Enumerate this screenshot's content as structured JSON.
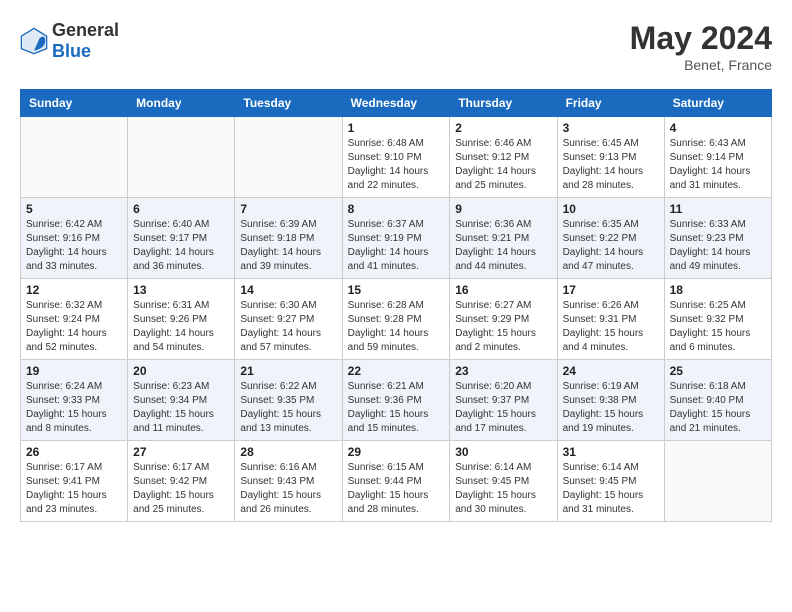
{
  "header": {
    "logo_general": "General",
    "logo_blue": "Blue",
    "month_year": "May 2024",
    "location": "Benet, France"
  },
  "weekdays": [
    "Sunday",
    "Monday",
    "Tuesday",
    "Wednesday",
    "Thursday",
    "Friday",
    "Saturday"
  ],
  "weeks": [
    [
      {
        "day": "",
        "info": ""
      },
      {
        "day": "",
        "info": ""
      },
      {
        "day": "",
        "info": ""
      },
      {
        "day": "1",
        "info": "Sunrise: 6:48 AM\nSunset: 9:10 PM\nDaylight: 14 hours\nand 22 minutes."
      },
      {
        "day": "2",
        "info": "Sunrise: 6:46 AM\nSunset: 9:12 PM\nDaylight: 14 hours\nand 25 minutes."
      },
      {
        "day": "3",
        "info": "Sunrise: 6:45 AM\nSunset: 9:13 PM\nDaylight: 14 hours\nand 28 minutes."
      },
      {
        "day": "4",
        "info": "Sunrise: 6:43 AM\nSunset: 9:14 PM\nDaylight: 14 hours\nand 31 minutes."
      }
    ],
    [
      {
        "day": "5",
        "info": "Sunrise: 6:42 AM\nSunset: 9:16 PM\nDaylight: 14 hours\nand 33 minutes."
      },
      {
        "day": "6",
        "info": "Sunrise: 6:40 AM\nSunset: 9:17 PM\nDaylight: 14 hours\nand 36 minutes."
      },
      {
        "day": "7",
        "info": "Sunrise: 6:39 AM\nSunset: 9:18 PM\nDaylight: 14 hours\nand 39 minutes."
      },
      {
        "day": "8",
        "info": "Sunrise: 6:37 AM\nSunset: 9:19 PM\nDaylight: 14 hours\nand 41 minutes."
      },
      {
        "day": "9",
        "info": "Sunrise: 6:36 AM\nSunset: 9:21 PM\nDaylight: 14 hours\nand 44 minutes."
      },
      {
        "day": "10",
        "info": "Sunrise: 6:35 AM\nSunset: 9:22 PM\nDaylight: 14 hours\nand 47 minutes."
      },
      {
        "day": "11",
        "info": "Sunrise: 6:33 AM\nSunset: 9:23 PM\nDaylight: 14 hours\nand 49 minutes."
      }
    ],
    [
      {
        "day": "12",
        "info": "Sunrise: 6:32 AM\nSunset: 9:24 PM\nDaylight: 14 hours\nand 52 minutes."
      },
      {
        "day": "13",
        "info": "Sunrise: 6:31 AM\nSunset: 9:26 PM\nDaylight: 14 hours\nand 54 minutes."
      },
      {
        "day": "14",
        "info": "Sunrise: 6:30 AM\nSunset: 9:27 PM\nDaylight: 14 hours\nand 57 minutes."
      },
      {
        "day": "15",
        "info": "Sunrise: 6:28 AM\nSunset: 9:28 PM\nDaylight: 14 hours\nand 59 minutes."
      },
      {
        "day": "16",
        "info": "Sunrise: 6:27 AM\nSunset: 9:29 PM\nDaylight: 15 hours\nand 2 minutes."
      },
      {
        "day": "17",
        "info": "Sunrise: 6:26 AM\nSunset: 9:31 PM\nDaylight: 15 hours\nand 4 minutes."
      },
      {
        "day": "18",
        "info": "Sunrise: 6:25 AM\nSunset: 9:32 PM\nDaylight: 15 hours\nand 6 minutes."
      }
    ],
    [
      {
        "day": "19",
        "info": "Sunrise: 6:24 AM\nSunset: 9:33 PM\nDaylight: 15 hours\nand 8 minutes."
      },
      {
        "day": "20",
        "info": "Sunrise: 6:23 AM\nSunset: 9:34 PM\nDaylight: 15 hours\nand 11 minutes."
      },
      {
        "day": "21",
        "info": "Sunrise: 6:22 AM\nSunset: 9:35 PM\nDaylight: 15 hours\nand 13 minutes."
      },
      {
        "day": "22",
        "info": "Sunrise: 6:21 AM\nSunset: 9:36 PM\nDaylight: 15 hours\nand 15 minutes."
      },
      {
        "day": "23",
        "info": "Sunrise: 6:20 AM\nSunset: 9:37 PM\nDaylight: 15 hours\nand 17 minutes."
      },
      {
        "day": "24",
        "info": "Sunrise: 6:19 AM\nSunset: 9:38 PM\nDaylight: 15 hours\nand 19 minutes."
      },
      {
        "day": "25",
        "info": "Sunrise: 6:18 AM\nSunset: 9:40 PM\nDaylight: 15 hours\nand 21 minutes."
      }
    ],
    [
      {
        "day": "26",
        "info": "Sunrise: 6:17 AM\nSunset: 9:41 PM\nDaylight: 15 hours\nand 23 minutes."
      },
      {
        "day": "27",
        "info": "Sunrise: 6:17 AM\nSunset: 9:42 PM\nDaylight: 15 hours\nand 25 minutes."
      },
      {
        "day": "28",
        "info": "Sunrise: 6:16 AM\nSunset: 9:43 PM\nDaylight: 15 hours\nand 26 minutes."
      },
      {
        "day": "29",
        "info": "Sunrise: 6:15 AM\nSunset: 9:44 PM\nDaylight: 15 hours\nand 28 minutes."
      },
      {
        "day": "30",
        "info": "Sunrise: 6:14 AM\nSunset: 9:45 PM\nDaylight: 15 hours\nand 30 minutes."
      },
      {
        "day": "31",
        "info": "Sunrise: 6:14 AM\nSunset: 9:45 PM\nDaylight: 15 hours\nand 31 minutes."
      },
      {
        "day": "",
        "info": ""
      }
    ]
  ]
}
